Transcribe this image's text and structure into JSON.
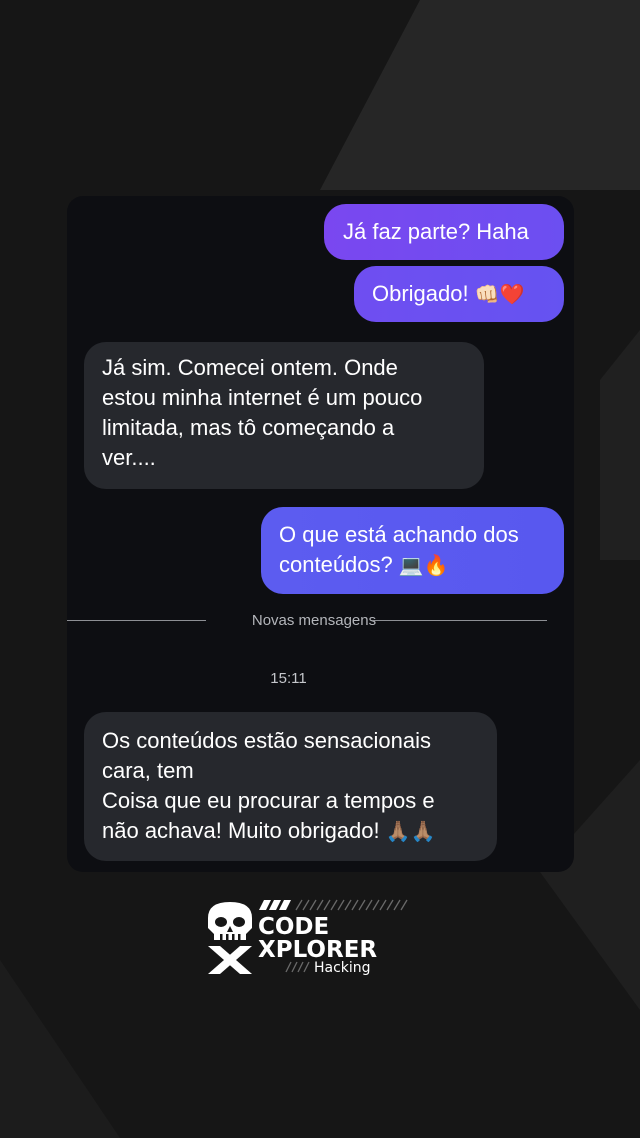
{
  "messages": [
    {
      "text": "Já faz parte? Haha",
      "direction": "outgoing"
    },
    {
      "text": "Obrigado!",
      "emoji": "👊🏻❤️",
      "direction": "outgoing"
    },
    {
      "lines": [
        "Já sim. Comecei ontem. Onde",
        "estou minha internet é um pouco",
        "limitada, mas tô começando a",
        "ver...."
      ],
      "direction": "incoming"
    },
    {
      "lines": [
        "O que está achando dos",
        "conteúdos?"
      ],
      "emoji": "💻🔥",
      "direction": "outgoing"
    },
    {
      "lines": [
        "Os conteúdos estão sensacionais",
        "cara, tem",
        "Coisa que eu procurar a tempos e",
        "não achava! Muito obrigado!"
      ],
      "emoji": "🙏🏽🙏🏽",
      "direction": "incoming"
    }
  ],
  "divider": {
    "label": "Novas mensagens"
  },
  "timestamp": "15:11",
  "brand": {
    "line1": "CODE",
    "line2": "XPLORER",
    "tagline": "Hacking"
  },
  "colors": {
    "outgoing_start": "#7a4df2",
    "outgoing_end": "#5a5cf0",
    "incoming": "#26282d",
    "background": "#161616",
    "card": "#0d0e12"
  }
}
